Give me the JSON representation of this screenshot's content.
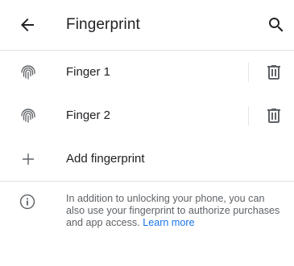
{
  "header": {
    "title": "Fingerprint",
    "back_icon": "arrow-left-icon",
    "search_icon": "search-icon"
  },
  "fingerprints": [
    {
      "label": "Finger 1",
      "icon": "fingerprint-icon",
      "action_icon": "trash-icon"
    },
    {
      "label": "Finger 2",
      "icon": "fingerprint-icon",
      "action_icon": "trash-icon"
    }
  ],
  "add": {
    "label": "Add fingerprint",
    "icon": "plus-icon"
  },
  "info": {
    "icon": "info-icon",
    "text": "In addition to unlocking your phone, you can also use your fingerprint to authorize purchases and app access.",
    "link": "Learn more"
  },
  "colors": {
    "accent": "#1a73e8",
    "text_primary": "#202124",
    "text_secondary": "#5f6368",
    "icon": "#5f6368",
    "divider": "#e0e0e0"
  }
}
